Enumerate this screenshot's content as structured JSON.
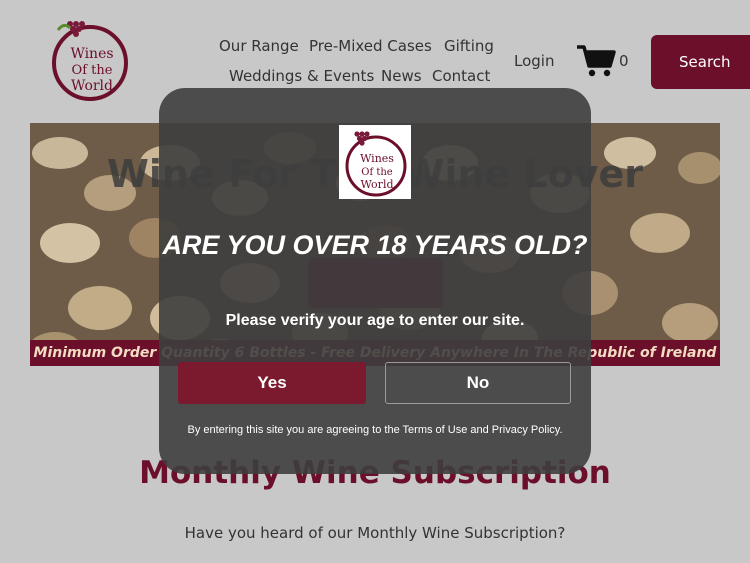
{
  "brand": {
    "logo_text": [
      "Wines",
      "Of the",
      "World"
    ],
    "color": "#6b0f2a"
  },
  "nav": {
    "row1": [
      "Our Range",
      "Pre-Mixed Cases",
      "Gifting"
    ],
    "row2": [
      "Weddings & Events",
      "News",
      "Contact"
    ],
    "login": "Login",
    "cart_count": "0",
    "search": "Search"
  },
  "hero": {
    "title": "Wine For The Wine Lover",
    "banner": "Minimum Order Quantity 6 Bottles - Free Delivery Anywhere In The Republic of Ireland"
  },
  "section": {
    "title": "Monthly Wine Subscription",
    "text": "Have you heard of our Monthly Wine Subscription?"
  },
  "age_gate": {
    "logo_text": [
      "Wines",
      "Of the",
      "World"
    ],
    "title": "ARE YOU OVER 18 YEARS OLD?",
    "subtitle": "Please verify your age to enter our site.",
    "yes": "Yes",
    "no": "No",
    "footer": "By entering this site you are agreeing to the Terms of Use and Privacy Policy."
  },
  "icons": {
    "cart": "cart-icon",
    "grapes": "grapes-icon"
  }
}
